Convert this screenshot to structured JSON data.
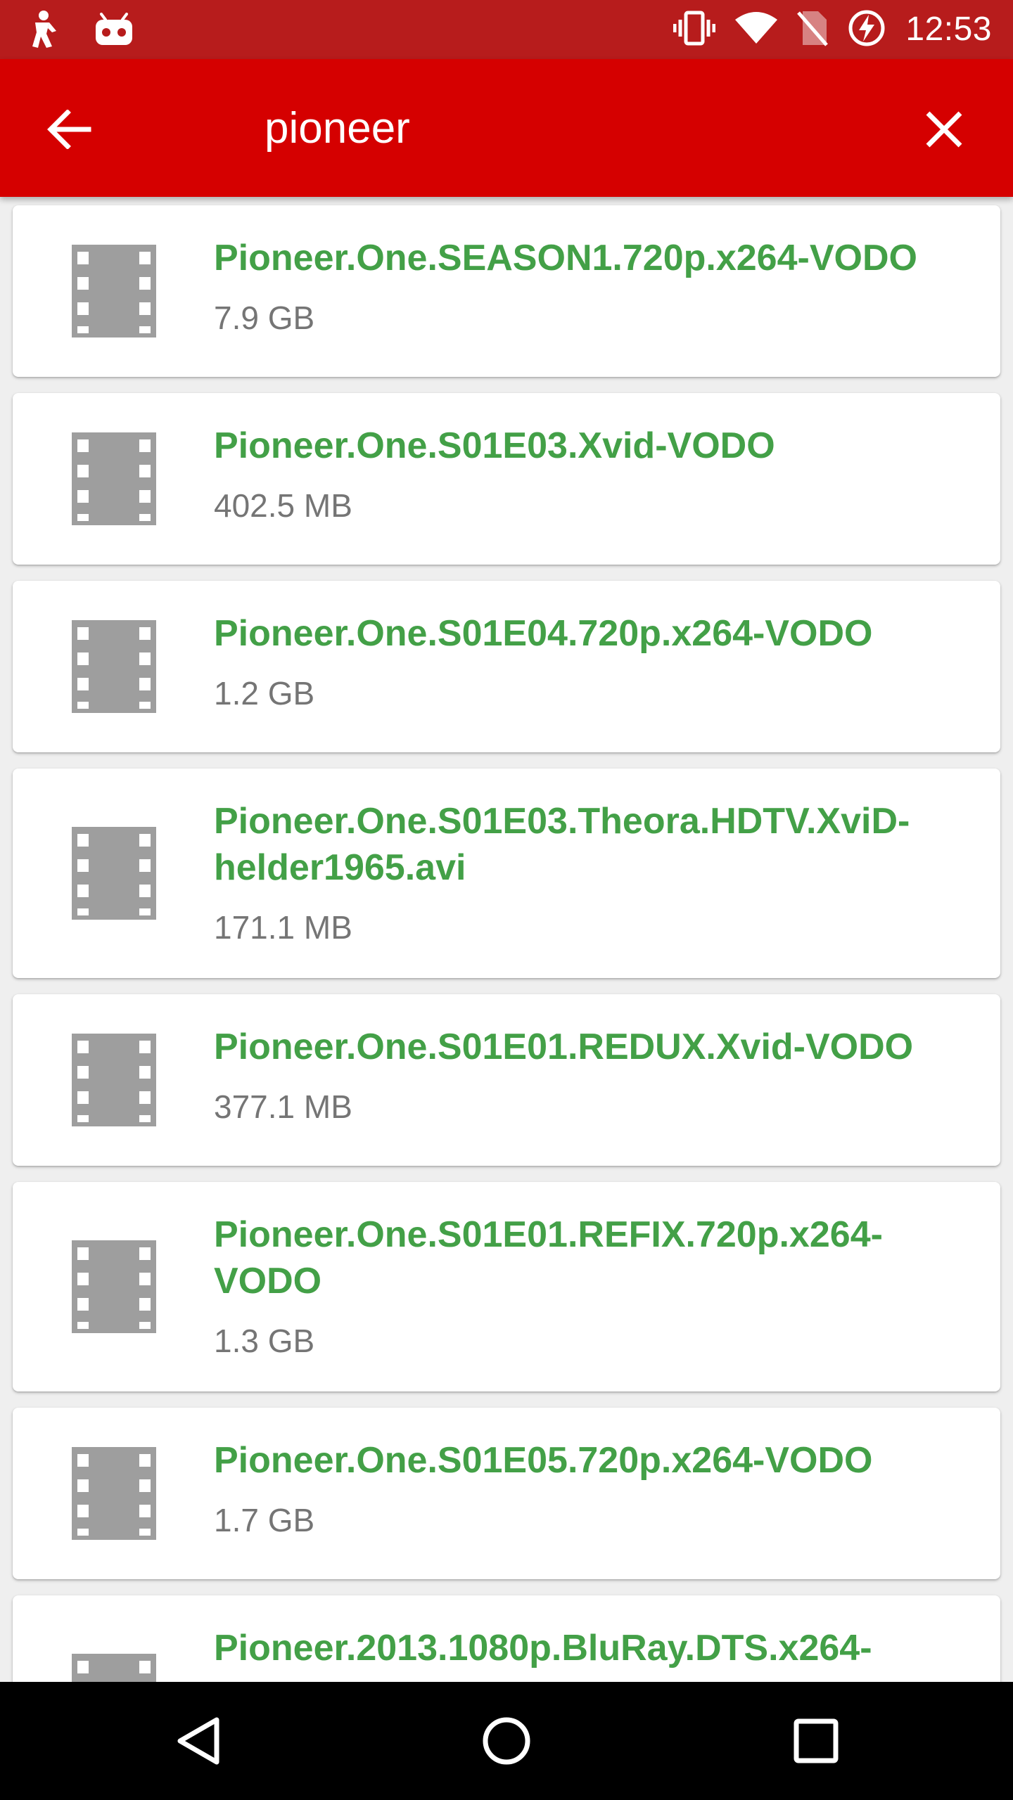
{
  "status_bar": {
    "time": "12:53",
    "icons": [
      "app-notification-icon",
      "android-robot-icon",
      "vibrate-icon",
      "wifi-icon",
      "no-sim-icon",
      "battery-charging-icon"
    ]
  },
  "search": {
    "value": "pioneer",
    "back_icon": "arrow-left-icon",
    "clear_icon": "close-icon"
  },
  "results": [
    {
      "title": "Pioneer.One.SEASON1.720p.x264-VODO",
      "size": "7.9 GB"
    },
    {
      "title": "Pioneer.One.S01E03.Xvid-VODO",
      "size": "402.5 MB"
    },
    {
      "title": "Pioneer.One.S01E04.720p.x264-VODO",
      "size": "1.2 GB"
    },
    {
      "title": "Pioneer.One.S01E03.Theora.HDTV.XviD-helder1965.avi",
      "size": "171.1 MB"
    },
    {
      "title": "Pioneer.One.S01E01.REDUX.Xvid-VODO",
      "size": "377.1 MB"
    },
    {
      "title": "Pioneer.One.S01E01.REFIX.720p.x264-VODO",
      "size": "1.3 GB"
    },
    {
      "title": "Pioneer.One.S01E05.720p.x264-VODO",
      "size": "1.7 GB"
    },
    {
      "title": "Pioneer.2013.1080p.BluRay.DTS.x264-",
      "size": ""
    }
  ],
  "nav_bar": {
    "icons": [
      "back-triangle-icon",
      "home-circle-icon",
      "recents-square-icon"
    ]
  },
  "colors": {
    "status_bar": "#b71c1c",
    "app_bar": "#d50000",
    "title_green": "#43a047",
    "size_gray": "#757575",
    "icon_gray": "#9e9e9e"
  }
}
